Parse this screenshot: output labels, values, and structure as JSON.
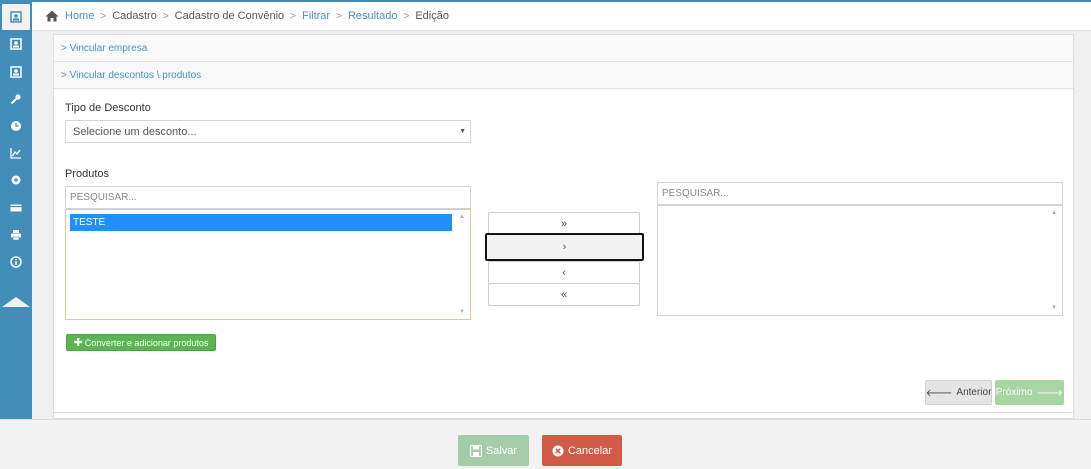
{
  "sidebar": {
    "icons": [
      "contact-card-icon",
      "contact-card-icon",
      "contact-card-icon",
      "key-icon",
      "clock-icon",
      "area-chart-icon",
      "cog-icon",
      "credit-card-icon",
      "print-icon",
      "info-icon"
    ],
    "active_index": 0,
    "color": "#438eb9"
  },
  "breadcrumb": {
    "home": "Home",
    "items": [
      "Cadastro",
      "Cadastro de Convênio",
      "Filtrar",
      "Resultado"
    ],
    "current": "Edição",
    "separator": ">"
  },
  "accordion": {
    "vincular_empresa": "> Vincular empresa",
    "vincular_descontos": "> Vincular descontos \\ produtos"
  },
  "form": {
    "tipo_desconto_label": "Tipo de Desconto",
    "tipo_desconto_value": "Selecione um desconto...",
    "produtos_label": "Produtos",
    "search_left_placeholder": "PESQUISAR...",
    "search_right_placeholder": "PESQUISAR...",
    "available_items": [
      "TESTE"
    ],
    "selected_items": []
  },
  "transfer": {
    "move_all_right": "»",
    "move_right": "›",
    "move_left": "‹",
    "move_all_left": "«"
  },
  "buttons": {
    "converter": "Converter e adicionar produtos",
    "anterior": "Anterior",
    "proximo": "Próximo",
    "salvar": "Salvar",
    "cancelar": "Cancelar"
  },
  "colors": {
    "link": "#4c8fbd",
    "green": "#5ab552",
    "danger": "#d15b47",
    "selection": "#1e90ff"
  }
}
